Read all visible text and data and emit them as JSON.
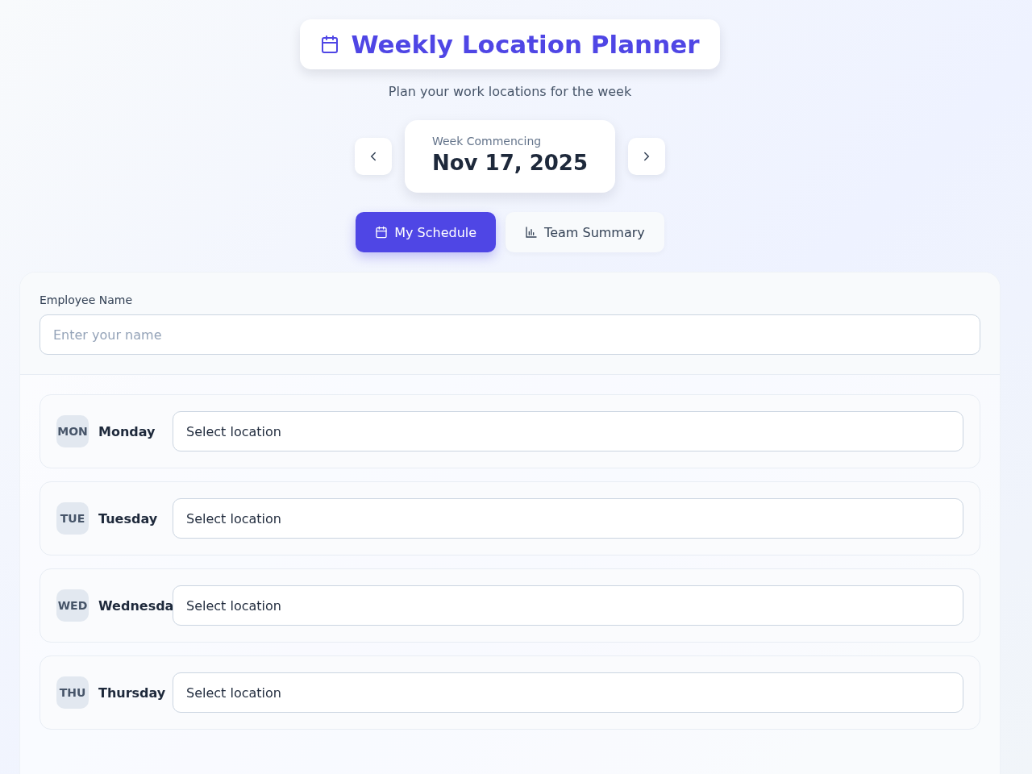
{
  "header": {
    "title": "Weekly Location Planner",
    "subtitle": "Plan your work locations for the week"
  },
  "week": {
    "label": "Week Commencing",
    "date": "Nov 17, 2025"
  },
  "tabs": [
    {
      "label": "My Schedule",
      "kind": "schedule",
      "selected": true
    },
    {
      "label": "Team Summary",
      "kind": "summary",
      "selected": false
    }
  ],
  "employee": {
    "label": "Employee Name",
    "placeholder": "Enter your name"
  },
  "days": [
    {
      "abbr": "MON",
      "name": "Monday",
      "location": "Select location"
    },
    {
      "abbr": "TUE",
      "name": "Tuesday",
      "location": "Select location"
    },
    {
      "abbr": "WED",
      "name": "Wednesda",
      "location": "Select location"
    },
    {
      "abbr": "THU",
      "name": "Thursday",
      "location": "Select location"
    }
  ]
}
